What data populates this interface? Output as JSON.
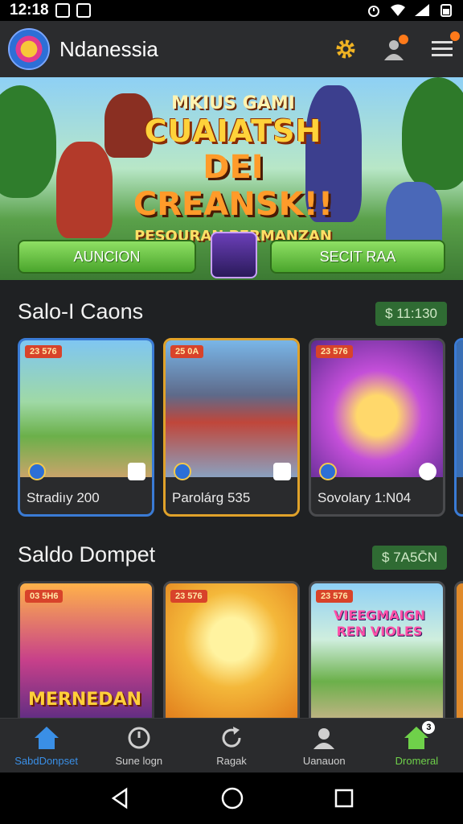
{
  "status_bar": {
    "time": "12:18"
  },
  "app": {
    "title": "Ndanessia"
  },
  "banner": {
    "line1": "MKIUS GAMI",
    "line2": "CUAIATSH",
    "line3": "DEI CREANSK!!",
    "line4": "PESQURAN PERMANZAN",
    "button_left": "AUNCION",
    "button_right": "SECIT RAA"
  },
  "section1": {
    "title": "Salo-I Caons",
    "amount": "$ 11:130",
    "cards": [
      {
        "badge": "23 576",
        "caption": "Stradiıy 200"
      },
      {
        "badge": "25 0A",
        "caption": "Parolárg 535"
      },
      {
        "badge": "23 576",
        "caption": "Sovolary 1:N04"
      }
    ]
  },
  "section2": {
    "title": "Saldo Dompet",
    "amount": "$ 7A5C̄N",
    "cards": [
      {
        "badge": "03 5H6",
        "art_text": "MERNEDAN"
      },
      {
        "badge": "23 576"
      },
      {
        "badge": "23 576",
        "art_text": "VIEEGMAIGN REN VIOLES"
      }
    ]
  },
  "bottom_nav": [
    {
      "label": "SabdDonpset",
      "icon": "home-icon"
    },
    {
      "label": "Sune logn",
      "icon": "clock-icon"
    },
    {
      "label": "Ragak",
      "icon": "refresh-icon"
    },
    {
      "label": "Uanauon",
      "icon": "user-icon"
    },
    {
      "label": "Dromeral",
      "icon": "home-icon",
      "badge": "3"
    }
  ],
  "colors": {
    "accent_blue": "#3a8fe6",
    "accent_green": "#6fd14a",
    "pill_green": "#2f6b33"
  }
}
